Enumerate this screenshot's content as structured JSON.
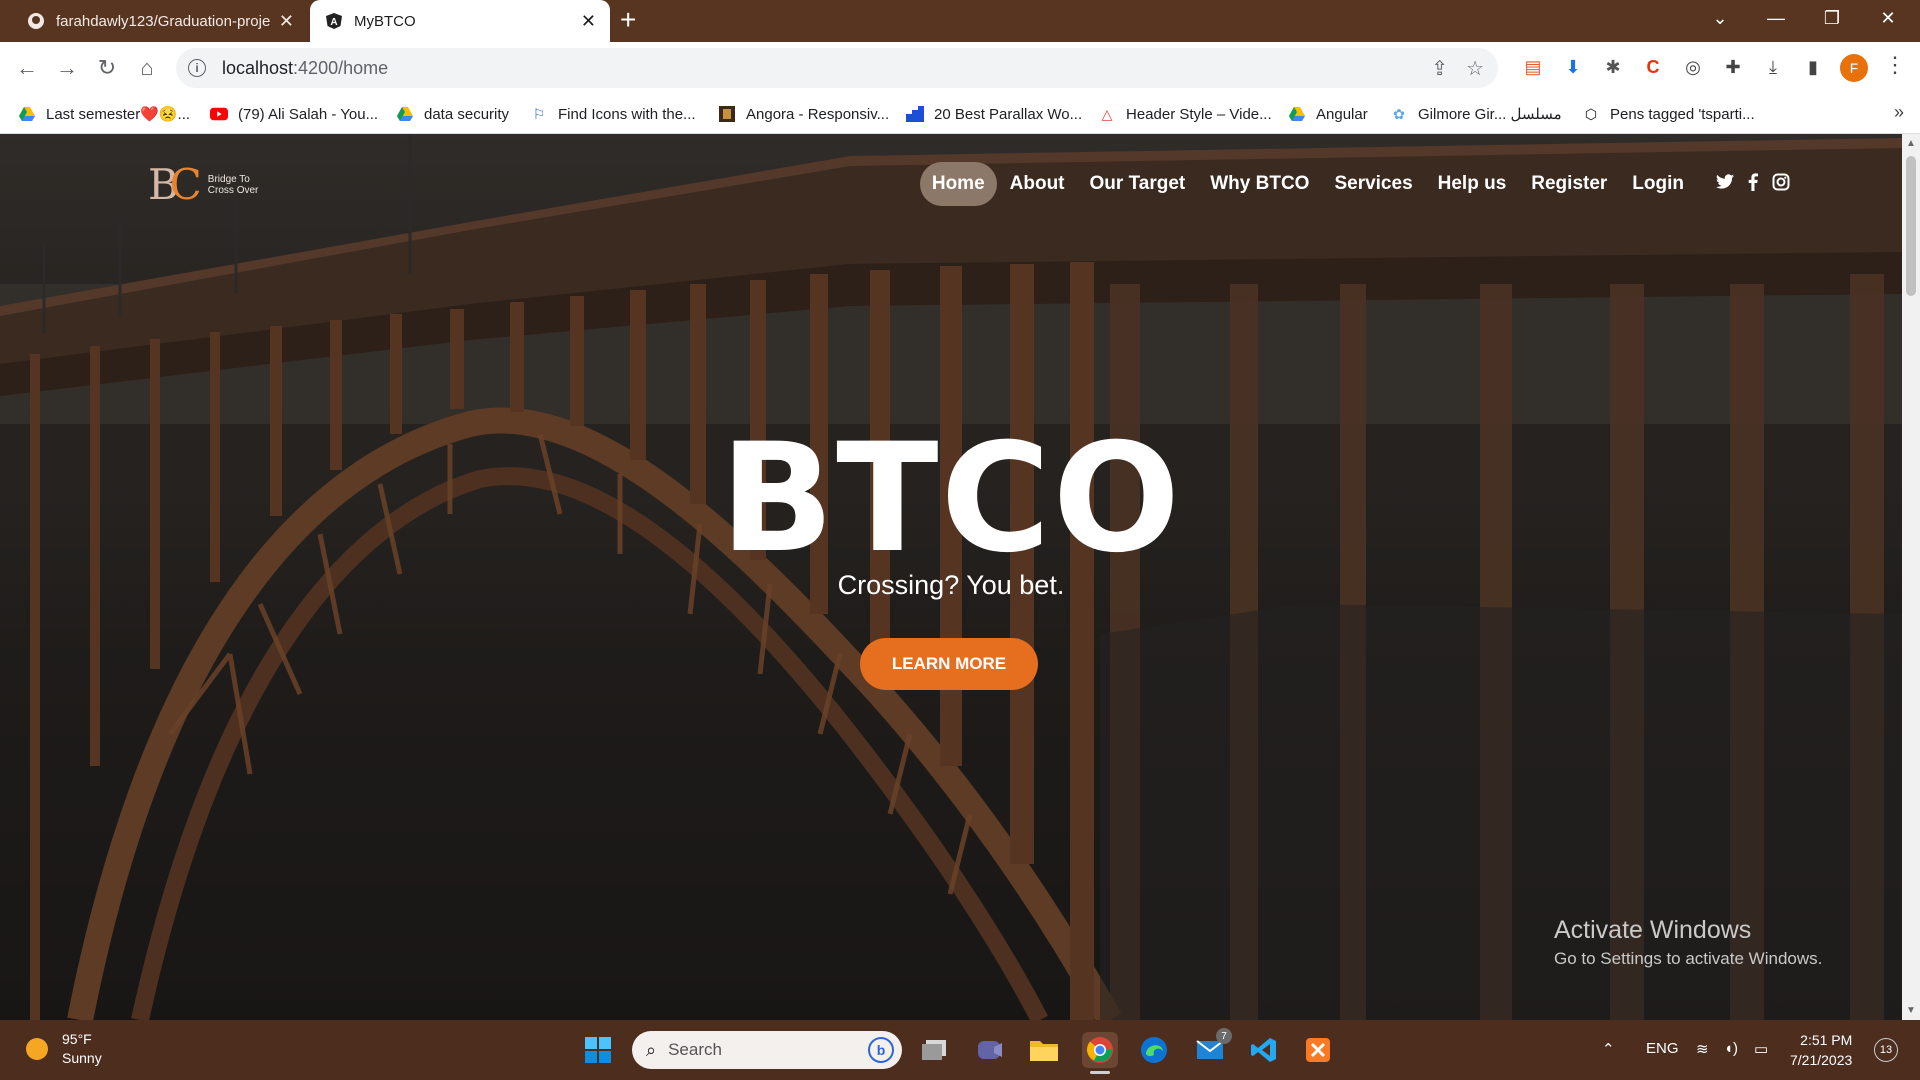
{
  "browser": {
    "tabs": [
      {
        "title": "farahdawly123/Graduation-proje",
        "icon": "github-icon"
      },
      {
        "title": "MyBTCO",
        "icon": "angular-icon"
      }
    ],
    "url": {
      "host": "localhost",
      "path": ":4200/home"
    },
    "profile_initial": "F",
    "bookmarks": [
      {
        "label": "Last semester❤️😣...",
        "icon": "google-drive-icon"
      },
      {
        "label": "(79) Ali Salah - You...",
        "icon": "youtube-icon"
      },
      {
        "label": "data security",
        "icon": "google-drive-icon"
      },
      {
        "label": "Find Icons with the...",
        "icon": "flag-icon"
      },
      {
        "label": "Angora - Responsiv...",
        "icon": "page-icon"
      },
      {
        "label": "20 Best Parallax Wo...",
        "icon": "page-icon"
      },
      {
        "label": "Header Style – Vide...",
        "icon": "triangle-icon"
      },
      {
        "label": "Angular",
        "icon": "google-drive-icon"
      },
      {
        "label": "Gilmore Gir... مسلسل",
        "icon": "globe-icon"
      },
      {
        "label": "Pens tagged 'tsparti...",
        "icon": "codepen-icon"
      }
    ]
  },
  "site": {
    "logo_text_line1": "Bridge To",
    "logo_text_line2": "Cross Over",
    "nav": [
      "Home",
      "About",
      "Our Target",
      "Why BTCO",
      "Services",
      "Help us",
      "Register",
      "Login"
    ],
    "active_nav": "Home",
    "social": [
      "twitter-icon",
      "facebook-icon",
      "instagram-icon"
    ],
    "hero_title": "BTCO",
    "hero_subtitle": "Crossing? You bet.",
    "cta_label": "LEARN MORE"
  },
  "watermark": {
    "title": "Activate Windows",
    "subtitle": "Go to Settings to activate Windows."
  },
  "taskbar": {
    "weather_temp": "95°F",
    "weather_desc": "Sunny",
    "search_placeholder": "Search",
    "mail_badge": "7",
    "language": "ENG",
    "time": "2:51 PM",
    "date": "7/21/2023",
    "notification_count": "13"
  },
  "colors": {
    "tabbar": "#583521",
    "accent": "#e56f1f",
    "nav_active": "#8c7868",
    "taskbar": "#4d2d1e"
  }
}
